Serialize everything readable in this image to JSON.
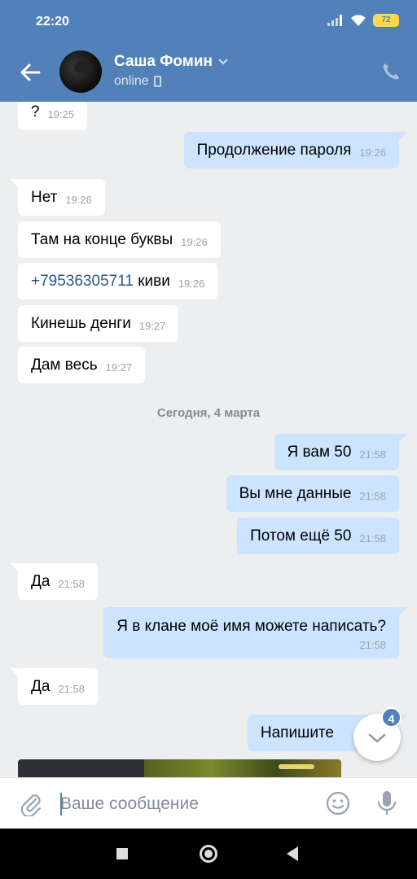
{
  "status_bar": {
    "time": "22:20",
    "battery": "72"
  },
  "header": {
    "contact_name": "Саша Фомин",
    "status": "online"
  },
  "date_separator": "Сегодня, 4 марта",
  "messages": [
    {
      "dir": "in",
      "text": "?",
      "time": "19:25"
    },
    {
      "dir": "out",
      "text": "Продолжение пароля",
      "time": "19:26"
    },
    {
      "dir": "in",
      "text": "Нет",
      "time": "19:26"
    },
    {
      "dir": "in",
      "text": "Там на конце буквы",
      "time": "19:26"
    },
    {
      "dir": "in",
      "link": "+79536305711",
      "text": " киви",
      "time": "19:26"
    },
    {
      "dir": "in",
      "text": "Кинешь денги",
      "time": "19:27"
    },
    {
      "dir": "in",
      "text": "Дам весь",
      "time": "19:27"
    },
    {
      "dir": "out",
      "text": "Я вам 50",
      "time": "21:58"
    },
    {
      "dir": "out",
      "text": "Вы мне данные",
      "time": "21:58"
    },
    {
      "dir": "out",
      "text": "Потом ещё 50",
      "time": "21:58"
    },
    {
      "dir": "in",
      "text": "Да",
      "time": "21:58"
    },
    {
      "dir": "out",
      "text": "Я в клане моё имя можете написать?",
      "time": "21:58"
    },
    {
      "dir": "in",
      "text": "Да",
      "time": "21:58"
    },
    {
      "dir": "out",
      "text": "Напишите",
      "time": ""
    }
  ],
  "unread_badge": "4",
  "composer": {
    "placeholder": "Ваше сообщение"
  },
  "colors": {
    "header": "#5181b8",
    "outgoing_bubble": "#cce4ff",
    "incoming_bubble": "#ffffff",
    "background": "#edeef0"
  }
}
